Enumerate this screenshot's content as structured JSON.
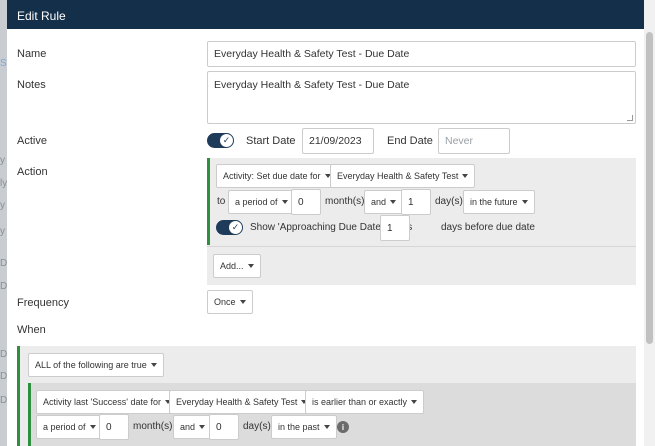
{
  "backdrop": {
    "snippets": [
      "SU",
      "y",
      "ly",
      "y",
      "y",
      "D",
      "D",
      "D",
      "D",
      "D"
    ]
  },
  "modal": {
    "title": "Edit Rule"
  },
  "form": {
    "name": {
      "label": "Name",
      "value": "Everyday Health & Safety Test - Due Date"
    },
    "notes": {
      "label": "Notes",
      "value": "Everyday Health & Safety Test - Due Date"
    },
    "active": {
      "label": "Active",
      "on": true
    },
    "start_date": {
      "label": "Start Date",
      "value": "21/09/2023"
    },
    "end_date": {
      "label": "End Date",
      "placeholder": "Never"
    },
    "action": {
      "label": "Action",
      "activity_select": "Activity: Set due date for",
      "course_select": "Everyday Health & Safety Test",
      "to_label": "to",
      "period_select": "a period of",
      "months_value": "0",
      "months_label": "month(s)",
      "and_select": "and",
      "days_value": "1",
      "days_label": "day(s)",
      "direction_select": "in the future",
      "approaching": {
        "on": true,
        "label": "Show 'Approaching Due Date' status",
        "value": "1",
        "suffix": "days before due date"
      },
      "add_button": "Add..."
    },
    "frequency": {
      "label": "Frequency",
      "value": "Once"
    },
    "when": {
      "label": "When",
      "group_select": "ALL of the following are true",
      "condition": {
        "field_select": "Activity last 'Success' date for",
        "course_select": "Everyday Health & Safety Test",
        "operator_select": "is earlier than or exactly",
        "period_select": "a period of",
        "months_value": "0",
        "months_label": "month(s)",
        "and_select": "and",
        "days_value": "0",
        "days_label": "day(s)",
        "direction_select": "in the past",
        "info_icon": "i"
      }
    }
  }
}
